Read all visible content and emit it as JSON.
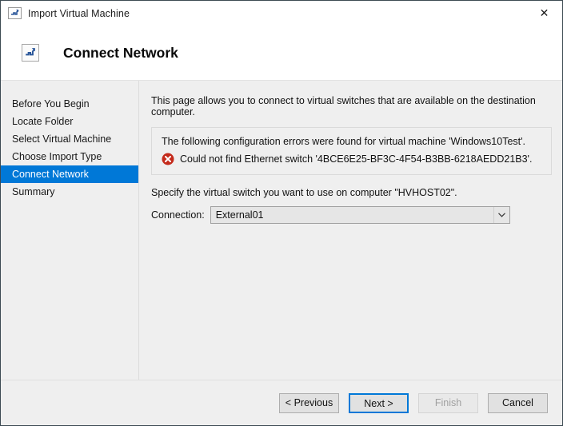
{
  "window": {
    "title": "Import Virtual Machine",
    "title_icon": "import-vm-icon",
    "close_label": "✕"
  },
  "header": {
    "icon": "import-vm-icon",
    "title": "Connect Network"
  },
  "sidebar": {
    "items": [
      {
        "label": "Before You Begin",
        "selected": false
      },
      {
        "label": "Locate Folder",
        "selected": false
      },
      {
        "label": "Select Virtual Machine",
        "selected": false
      },
      {
        "label": "Choose Import Type",
        "selected": false
      },
      {
        "label": "Connect Network",
        "selected": true
      },
      {
        "label": "Summary",
        "selected": false
      }
    ],
    "selected_color": "#0078d7"
  },
  "content": {
    "intro": "This page allows you to connect to virtual switches that are available on the destination computer.",
    "error_panel": {
      "heading": "The following configuration errors were found for virtual machine 'Windows10Test'.",
      "icon": "error-circle-icon",
      "icon_color": "#c42b1c",
      "message": "Could not find Ethernet switch '4BCE6E25-BF3C-4F54-B3BB-6218AEDD21B3'."
    },
    "specify": "Specify the virtual switch you want to use on computer \"HVHOST02\".",
    "connection": {
      "label": "Connection:",
      "value": "External01",
      "arrow_icon": "chevron-down-icon"
    }
  },
  "footer": {
    "previous_label": "< Previous",
    "next_label": "Next >",
    "finish_label": "Finish",
    "cancel_label": "Cancel"
  }
}
